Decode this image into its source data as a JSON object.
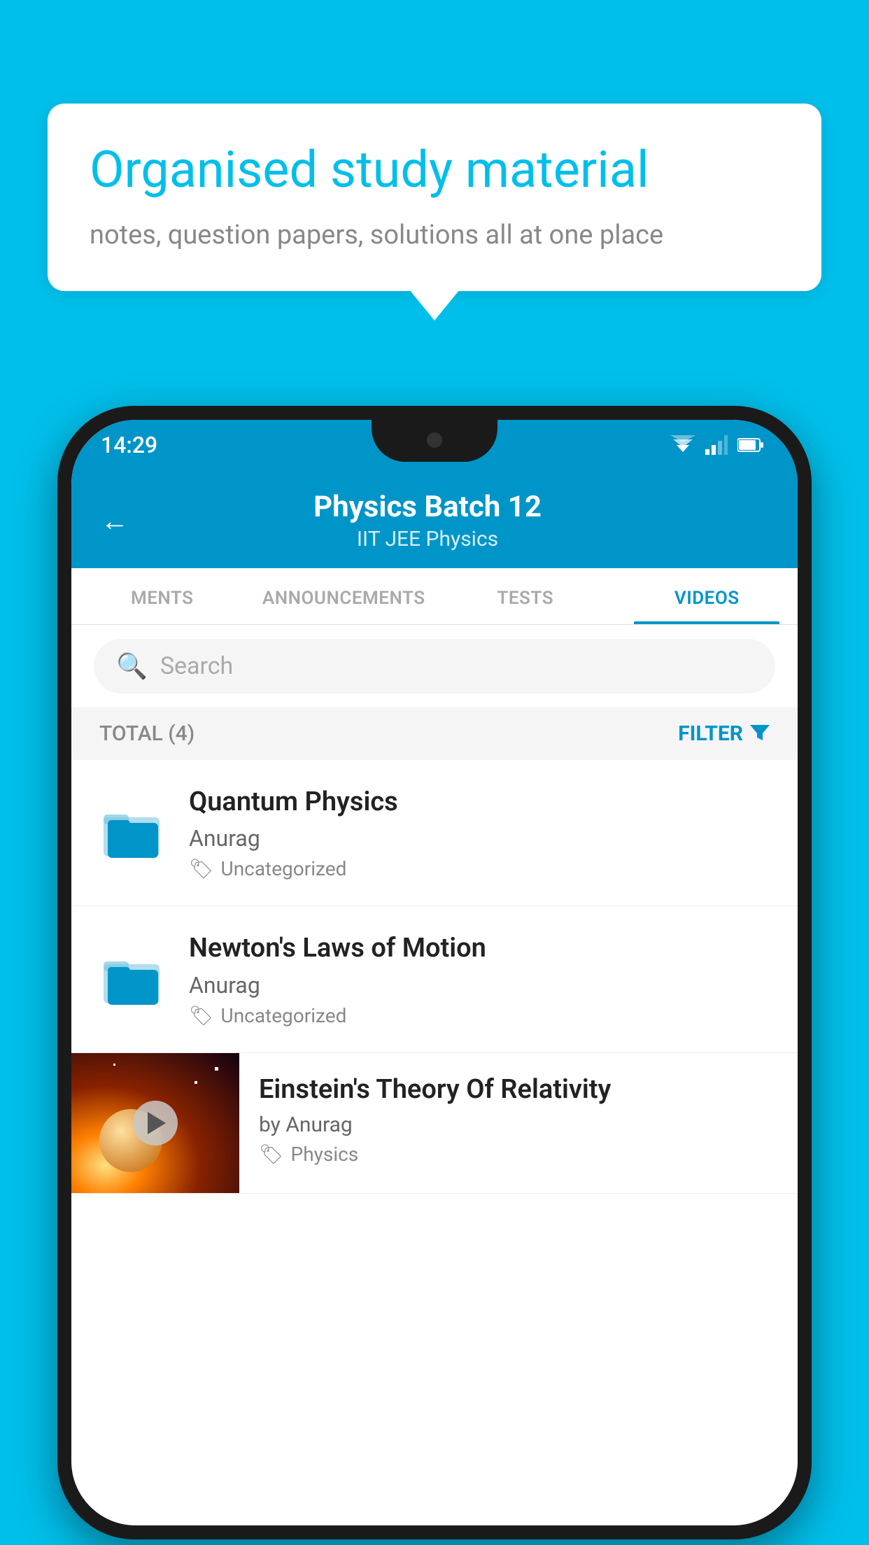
{
  "background": {
    "color": "#00BFEA"
  },
  "bubble": {
    "headline": "Organised study material",
    "subtext": "notes, question papers, solutions all at one place"
  },
  "phone": {
    "statusBar": {
      "time": "14:29"
    },
    "header": {
      "title": "Physics Batch 12",
      "subtitle": "IIT JEE   Physics"
    },
    "tabs": [
      {
        "label": "MENTS",
        "active": false
      },
      {
        "label": "ANNOUNCEMENTS",
        "active": false
      },
      {
        "label": "TESTS",
        "active": false
      },
      {
        "label": "VIDEOS",
        "active": true
      }
    ],
    "search": {
      "placeholder": "Search"
    },
    "filterBar": {
      "total": "TOTAL (4)",
      "filterLabel": "FILTER"
    },
    "videos": [
      {
        "title": "Quantum Physics",
        "author": "Anurag",
        "tag": "Uncategorized",
        "type": "folder"
      },
      {
        "title": "Newton's Laws of Motion",
        "author": "Anurag",
        "tag": "Uncategorized",
        "type": "folder"
      },
      {
        "title": "Einstein's Theory Of Relativity",
        "author": "by Anurag",
        "tag": "Physics",
        "type": "thumbnail"
      }
    ]
  }
}
